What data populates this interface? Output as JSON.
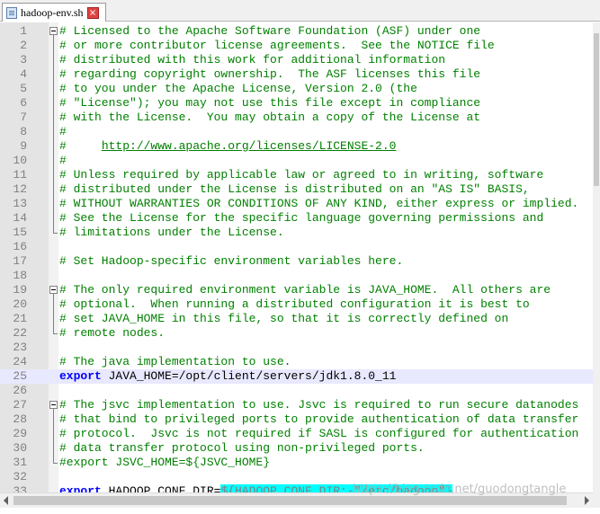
{
  "tab": {
    "title": "hadoop-env.sh",
    "close_glyph": "×"
  },
  "editor": {
    "current_line": 25,
    "lines": [
      {
        "n": "1",
        "fold": "start",
        "segs": [
          {
            "t": "# Licensed to the Apache Software Foundation (ASF) under one",
            "c": "c"
          }
        ]
      },
      {
        "n": "2",
        "fold": "mid",
        "segs": [
          {
            "t": "# or more contributor license agreements.  See the NOTICE file",
            "c": "c"
          }
        ]
      },
      {
        "n": "3",
        "fold": "mid",
        "segs": [
          {
            "t": "# distributed with this work for additional information",
            "c": "c"
          }
        ]
      },
      {
        "n": "4",
        "fold": "mid",
        "segs": [
          {
            "t": "# regarding copyright ownership.  The ASF licenses this file",
            "c": "c"
          }
        ]
      },
      {
        "n": "5",
        "fold": "mid",
        "segs": [
          {
            "t": "# to you under the Apache License, Version 2.0 (the",
            "c": "c"
          }
        ]
      },
      {
        "n": "6",
        "fold": "mid",
        "segs": [
          {
            "t": "# \"License\"); you may not use this file except in compliance",
            "c": "c"
          }
        ]
      },
      {
        "n": "7",
        "fold": "mid",
        "segs": [
          {
            "t": "# with the License.  You may obtain a copy of the License at",
            "c": "c"
          }
        ]
      },
      {
        "n": "8",
        "fold": "mid",
        "segs": [
          {
            "t": "#",
            "c": "c"
          }
        ]
      },
      {
        "n": "9",
        "fold": "mid",
        "segs": [
          {
            "t": "#     ",
            "c": "c"
          },
          {
            "t": "http://www.apache.org/licenses/LICENSE-2.0",
            "c": "u"
          }
        ]
      },
      {
        "n": "10",
        "fold": "mid",
        "segs": [
          {
            "t": "#",
            "c": "c"
          }
        ]
      },
      {
        "n": "11",
        "fold": "mid",
        "segs": [
          {
            "t": "# Unless required by applicable law or agreed to in writing, software",
            "c": "c"
          }
        ]
      },
      {
        "n": "12",
        "fold": "mid",
        "segs": [
          {
            "t": "# distributed under the License is distributed on an \"AS IS\" BASIS,",
            "c": "c"
          }
        ]
      },
      {
        "n": "13",
        "fold": "mid",
        "segs": [
          {
            "t": "# WITHOUT WARRANTIES OR CONDITIONS OF ANY KIND, either express or implied.",
            "c": "c"
          }
        ]
      },
      {
        "n": "14",
        "fold": "mid",
        "segs": [
          {
            "t": "# See the License for the specific language governing permissions and",
            "c": "c"
          }
        ]
      },
      {
        "n": "15",
        "fold": "end",
        "segs": [
          {
            "t": "# limitations under the License.",
            "c": "c"
          }
        ]
      },
      {
        "n": "16",
        "fold": "",
        "segs": []
      },
      {
        "n": "17",
        "fold": "",
        "segs": [
          {
            "t": "# Set Hadoop-specific environment variables here.",
            "c": "c"
          }
        ]
      },
      {
        "n": "18",
        "fold": "",
        "segs": []
      },
      {
        "n": "19",
        "fold": "start",
        "segs": [
          {
            "t": "# The only required environment variable is JAVA_HOME.  All others are",
            "c": "c"
          }
        ]
      },
      {
        "n": "20",
        "fold": "mid",
        "segs": [
          {
            "t": "# optional.  When running a distributed configuration it is best to",
            "c": "c"
          }
        ]
      },
      {
        "n": "21",
        "fold": "mid",
        "segs": [
          {
            "t": "# set JAVA_HOME in this file, so that it is correctly defined on",
            "c": "c"
          }
        ]
      },
      {
        "n": "22",
        "fold": "end",
        "segs": [
          {
            "t": "# remote nodes.",
            "c": "c"
          }
        ]
      },
      {
        "n": "23",
        "fold": "",
        "segs": []
      },
      {
        "n": "24",
        "fold": "",
        "segs": [
          {
            "t": "# The java implementation to use.",
            "c": "c"
          }
        ]
      },
      {
        "n": "25",
        "fold": "",
        "segs": [
          {
            "t": "export",
            "c": "k"
          },
          {
            "t": " JAVA_HOME=/opt/client/servers/jdk1.8.0_11",
            "c": ""
          }
        ]
      },
      {
        "n": "26",
        "fold": "",
        "segs": []
      },
      {
        "n": "27",
        "fold": "start",
        "segs": [
          {
            "t": "# The jsvc implementation to use. Jsvc is required to run secure datanodes",
            "c": "c"
          }
        ]
      },
      {
        "n": "28",
        "fold": "mid",
        "segs": [
          {
            "t": "# that bind to privileged ports to provide authentication of data transfer",
            "c": "c"
          }
        ]
      },
      {
        "n": "29",
        "fold": "mid",
        "segs": [
          {
            "t": "# protocol.  Jsvc is not required if SASL is configured for authentication",
            "c": "c"
          }
        ]
      },
      {
        "n": "30",
        "fold": "mid",
        "segs": [
          {
            "t": "# data transfer protocol using non-privileged ports.",
            "c": "c"
          }
        ]
      },
      {
        "n": "31",
        "fold": "end",
        "segs": [
          {
            "t": "#export JSVC_HOME=${JSVC_HOME}",
            "c": "c"
          }
        ]
      },
      {
        "n": "32",
        "fold": "",
        "segs": []
      },
      {
        "n": "33",
        "fold": "",
        "segs": [
          {
            "t": "export",
            "c": "k"
          },
          {
            "t": " HADOOP_CONF_DIR=",
            "c": ""
          },
          {
            "t": "${HADOOP_CONF_DIR:-\"/etc/hadoop\"}",
            "c": "hl"
          }
        ]
      }
    ]
  },
  "watermark": "https://blog.csdn.net/guodongtangle"
}
